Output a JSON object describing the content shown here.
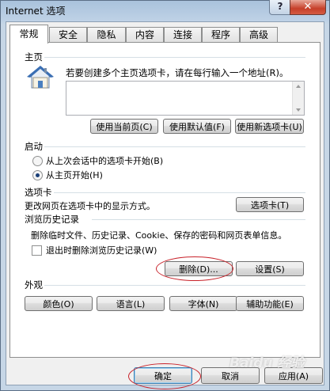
{
  "window": {
    "title": "Internet 选项",
    "help_glyph": "?",
    "close_glyph": "✕"
  },
  "tabs": [
    "常规",
    "安全",
    "隐私",
    "内容",
    "连接",
    "程序",
    "高级"
  ],
  "home": {
    "section": "主页",
    "description": "若要创建多个主页选项卡，请在每行输入一个地址(R)。",
    "url_value": "",
    "buttons": [
      "使用当前页(C)",
      "使用默认值(F)",
      "使用新选项卡(U)"
    ]
  },
  "startup": {
    "section": "启动",
    "options": [
      "从上次会话中的选项卡开始(B)",
      "从主页开始(H)"
    ],
    "selected_index": 1
  },
  "tabs_section": {
    "section": "选项卡",
    "description": "更改网页在选项卡中的显示方式。",
    "button": "选项卡(T)"
  },
  "history": {
    "section": "浏览历史记录",
    "description": "删除临时文件、历史记录、Cookie、保存的密码和网页表单信息。",
    "checkbox_label": "退出时删除浏览历史记录(W)",
    "checkbox_checked": false,
    "delete_button": "删除(D)...",
    "settings_button": "设置(S)"
  },
  "appearance": {
    "section": "外观",
    "buttons": [
      "颜色(O)",
      "语言(L)",
      "字体(N)",
      "辅助功能(E)"
    ]
  },
  "footer": {
    "ok": "确定",
    "cancel": "取消",
    "apply": "应用(A)",
    "watermark": "Baidu 经验"
  },
  "colors": {
    "highlight_oval": "#c8222a",
    "house_roof": "#3b6fb3"
  },
  "icons": [
    "help-icon",
    "close-icon",
    "home-icon"
  ]
}
